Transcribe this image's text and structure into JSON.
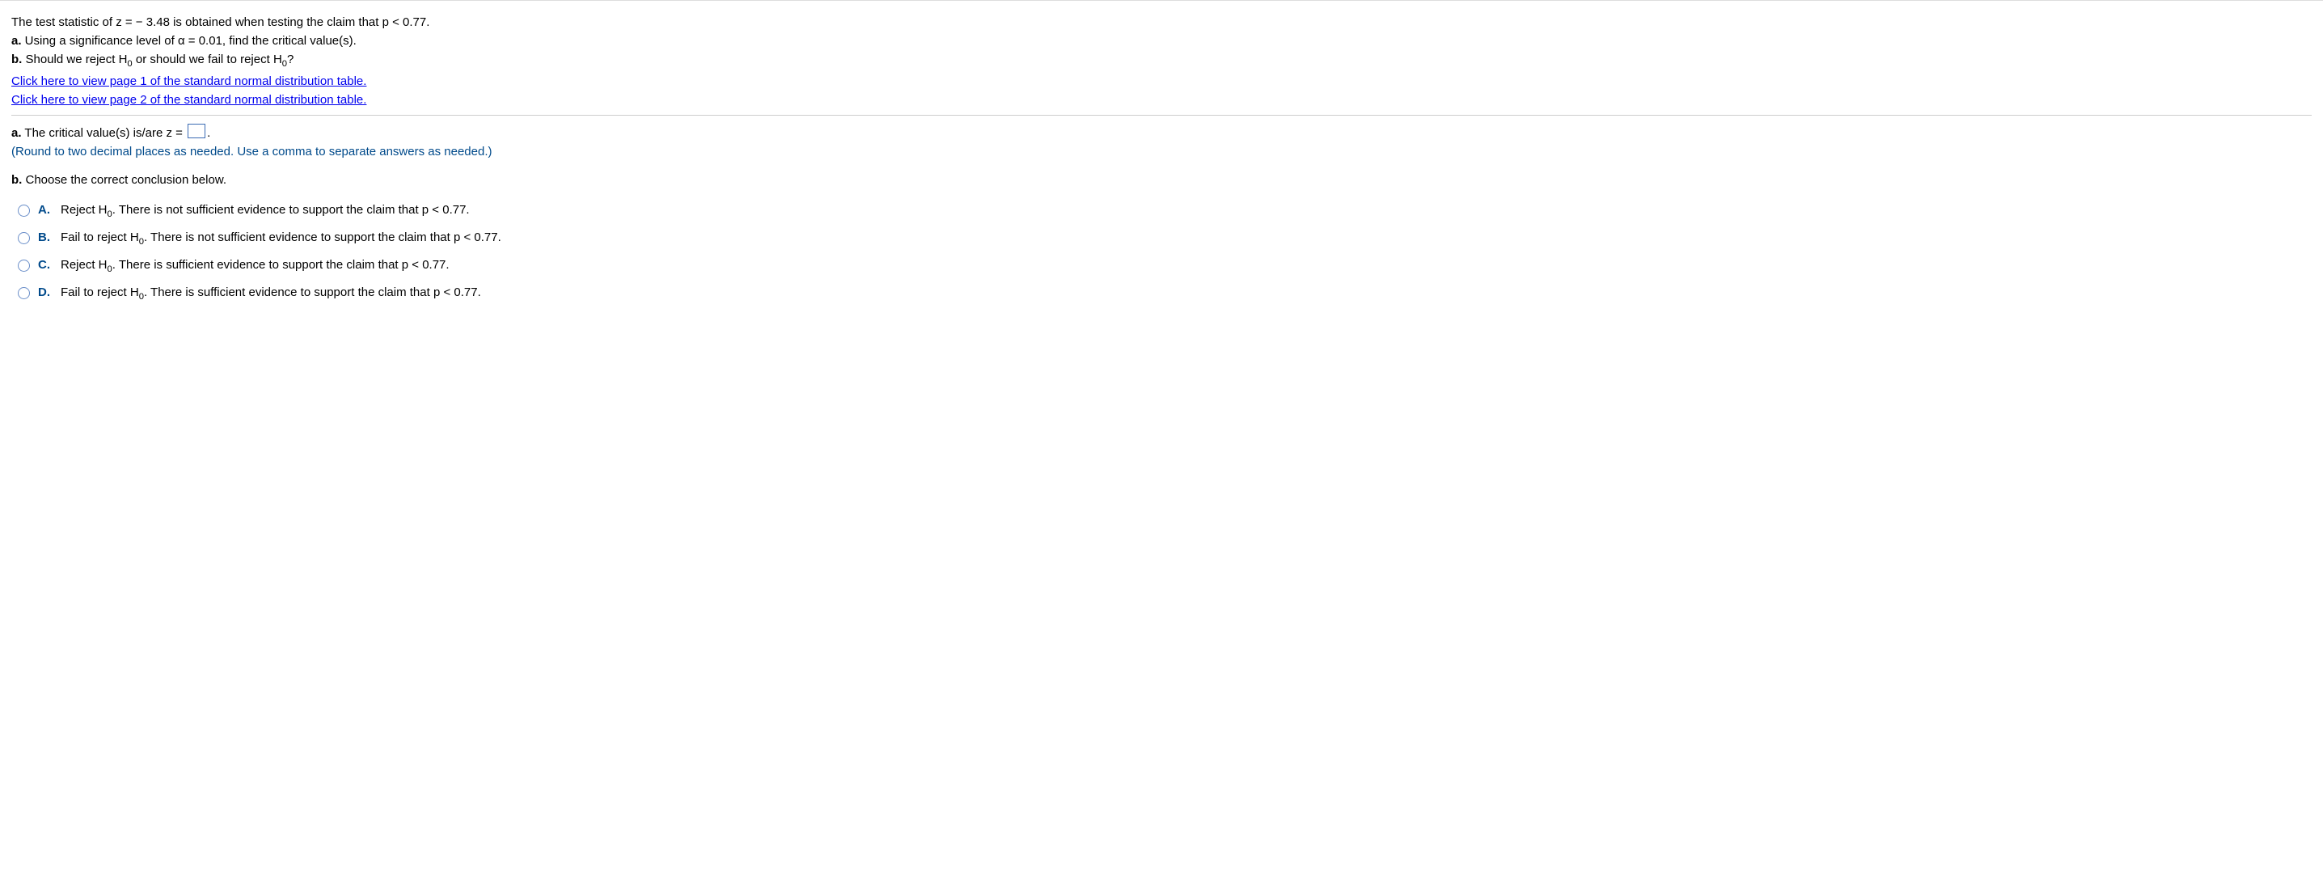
{
  "question": {
    "intro": "The test statistic of z = − 3.48 is obtained when testing the claim that p < 0.77.",
    "partA_prefix": "a.",
    "partA_text": " Using a significance level of α = 0.01, find the critical value(s).",
    "partB_prefix": "b.",
    "partB_pre": " Should we reject H",
    "partB_sub1": "0",
    "partB_mid": " or should we fail to reject H",
    "partB_sub2": "0",
    "partB_end": "?",
    "link1": "Click here to view page 1 of the standard normal distribution table.",
    "link2": "Click here to view page 2 of the standard normal distribution table."
  },
  "answerA": {
    "prefix": "a.",
    "text1": " The critical value(s) is/are z =",
    "period": ".",
    "hint": "(Round to two decimal places as needed. Use a comma to separate answers as needed.)"
  },
  "answerB": {
    "prefix": "b.",
    "header": " Choose the correct conclusion below.",
    "options": [
      {
        "letter": "A.",
        "pre": "Reject H",
        "sub": "0",
        "post": ". There is not sufficient evidence to support the claim that p < 0.77."
      },
      {
        "letter": "B.",
        "pre": "Fail to reject H",
        "sub": "0",
        "post": ". There is not sufficient evidence to support the claim that p < 0.77."
      },
      {
        "letter": "C.",
        "pre": "Reject H",
        "sub": "0",
        "post": ". There is sufficient evidence to support the claim that p < 0.77."
      },
      {
        "letter": "D.",
        "pre": "Fail to reject H",
        "sub": "0",
        "post": ". There is sufficient evidence to support the claim that p < 0.77."
      }
    ]
  }
}
